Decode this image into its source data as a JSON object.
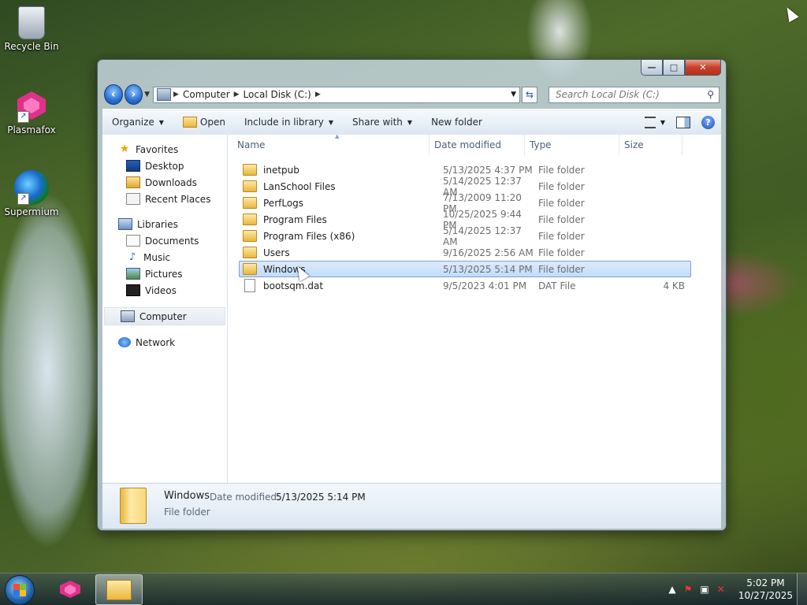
{
  "desktop": {
    "icons": [
      {
        "label": "Recycle Bin"
      },
      {
        "label": "Plasmafox"
      },
      {
        "label": "Supermium"
      }
    ]
  },
  "window": {
    "controls": {
      "minimize": "—",
      "maximize": "□",
      "close": "✕"
    },
    "address": {
      "crumbs": [
        "Computer",
        "Local Disk (C:)"
      ],
      "search_placeholder": "Search Local Disk (C:)"
    },
    "toolbar": {
      "organize": "Organize",
      "open": "Open",
      "include_in_library": "Include in library",
      "share_with": "Share with",
      "new_folder": "New folder"
    },
    "nav": {
      "favorites": "Favorites",
      "desktop": "Desktop",
      "downloads": "Downloads",
      "recent_places": "Recent Places",
      "libraries": "Libraries",
      "documents": "Documents",
      "music": "Music",
      "pictures": "Pictures",
      "videos": "Videos",
      "computer": "Computer",
      "network": "Network"
    },
    "columns": {
      "name": "Name",
      "date": "Date modified",
      "type": "Type",
      "size": "Size"
    },
    "files": [
      {
        "name": "inetpub",
        "date": "5/13/2025 4:37 PM",
        "type": "File folder",
        "size": ""
      },
      {
        "name": "LanSchool Files",
        "date": "5/14/2025 12:37 AM",
        "type": "File folder",
        "size": ""
      },
      {
        "name": "PerfLogs",
        "date": "7/13/2009 11:20 PM",
        "type": "File folder",
        "size": ""
      },
      {
        "name": "Program Files",
        "date": "10/25/2025 9:44 PM",
        "type": "File folder",
        "size": ""
      },
      {
        "name": "Program Files (x86)",
        "date": "5/14/2025 12:37 AM",
        "type": "File folder",
        "size": ""
      },
      {
        "name": "Users",
        "date": "9/16/2025 2:56 AM",
        "type": "File folder",
        "size": ""
      },
      {
        "name": "Windows",
        "date": "5/13/2025 5:14 PM",
        "type": "File folder",
        "size": ""
      },
      {
        "name": "bootsqm.dat",
        "date": "9/5/2023 4:01 PM",
        "type": "DAT File",
        "size": "4 KB"
      }
    ],
    "selected_index": 6,
    "details": {
      "name": "Windows",
      "date_label": "Date modified:",
      "date_value": "5/13/2025 5:14 PM",
      "type": "File folder"
    }
  },
  "taskbar": {
    "clock_time": "5:02 PM",
    "clock_date": "10/27/2025"
  }
}
